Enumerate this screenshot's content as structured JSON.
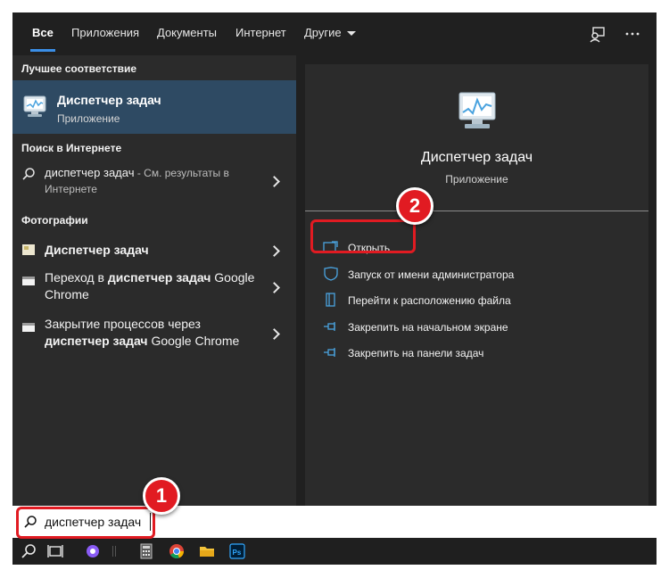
{
  "tabs": {
    "all": "Все",
    "apps": "Приложения",
    "documents": "Документы",
    "web": "Интернет",
    "more": "Другие"
  },
  "left": {
    "best_match_header": "Лучшее соответствие",
    "best_match": {
      "title": "Диспетчер задач",
      "subtitle": "Приложение"
    },
    "web_header": "Поиск в Интернете",
    "web_result": {
      "query": "диспетчер задач",
      "suffix": " - См. результаты в",
      "line2": "Интернете"
    },
    "photos_header": "Фотографии",
    "photos": [
      {
        "pre": "",
        "bold": "Диспетчер задач",
        "post": ""
      },
      {
        "pre": "Переход в ",
        "bold": "диспетчер задач",
        "post": " Google Chrome"
      },
      {
        "pre": "Закрытие процессов через ",
        "bold": "диспетчер задач",
        "post": " Google Chrome"
      }
    ]
  },
  "right": {
    "app_name": "Диспетчер задач",
    "app_type": "Приложение",
    "actions": {
      "open": "Открыть",
      "run_as_admin": "Запуск от имени администратора",
      "open_location": "Перейти к расположению файла",
      "pin_start": "Закрепить на начальном экране",
      "pin_taskbar": "Закрепить на панели задач"
    }
  },
  "search": {
    "value": "диспетчер задач"
  },
  "badges": {
    "one": "1",
    "two": "2"
  },
  "colors": {
    "accent": "#3a8ee6",
    "selected": "#2e4a63",
    "highlight": "#e11b22"
  },
  "icons": [
    "feedback-icon",
    "more-icon",
    "task-manager-icon",
    "search-icon",
    "chevron-right-icon",
    "open-icon",
    "shield-icon",
    "folder-icon",
    "pin-icon",
    "task-view-icon",
    "cortana-icon",
    "chrome-icon",
    "file-explorer-icon",
    "photoshop-icon"
  ]
}
